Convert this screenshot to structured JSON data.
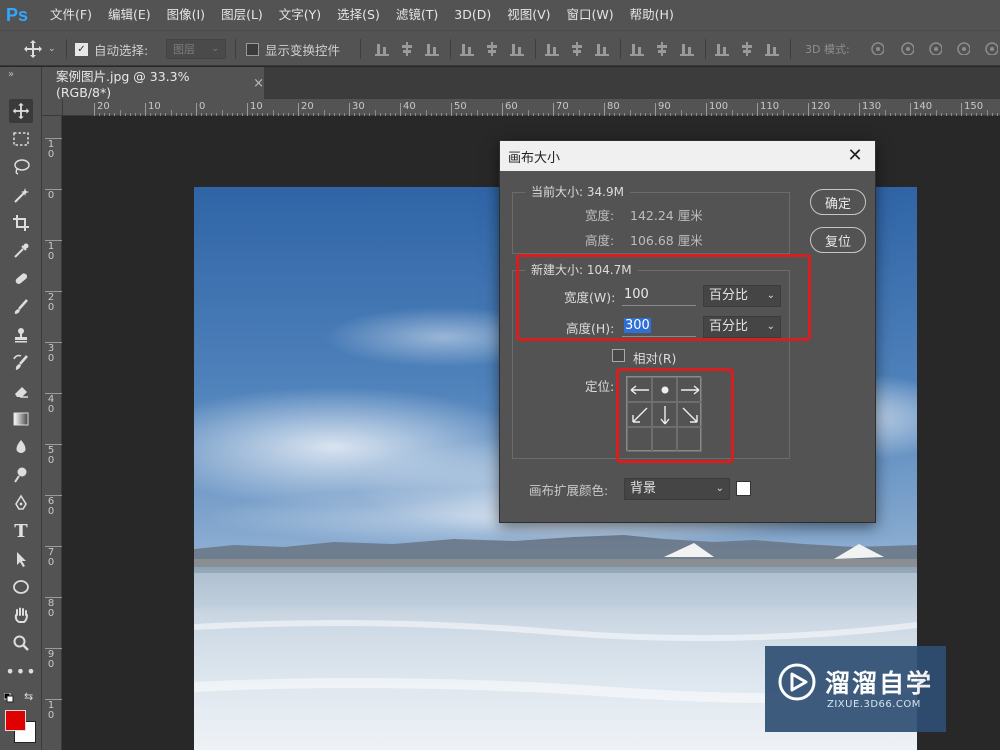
{
  "app": {
    "logo": "Ps",
    "menu": [
      "文件(F)",
      "编辑(E)",
      "图像(I)",
      "图层(L)",
      "文字(Y)",
      "选择(S)",
      "滤镜(T)",
      "3D(D)",
      "视图(V)",
      "窗口(W)",
      "帮助(H)"
    ]
  },
  "options_bar": {
    "auto_select_label": "自动选择:",
    "auto_select_checked": true,
    "layer_select": "图层",
    "show_transform_label": "显示变换控件",
    "mode_3d_label": "3D 模式:"
  },
  "document_tab": {
    "title": "案例图片.jpg @ 33.3%(RGB/8*)",
    "close": "×"
  },
  "ruler": {
    "top_ticks": [
      "20",
      "10",
      "0",
      "10",
      "20",
      "30",
      "40",
      "50",
      "60",
      "70",
      "80",
      "90",
      "100",
      "110",
      "120",
      "130",
      "140",
      "150"
    ],
    "left_ticks": [
      "1\n0",
      "0",
      "1\n0",
      "2\n0",
      "3\n0",
      "4\n0",
      "5\n0",
      "6\n0",
      "7\n0",
      "8\n0",
      "9\n0",
      "1\n0"
    ]
  },
  "dialog": {
    "title": "画布大小",
    "current_size_label": "当前大小: 34.9M",
    "current_width_label": "宽度:",
    "current_width_value": "142.24 厘米",
    "current_height_label": "高度:",
    "current_height_value": "106.68 厘米",
    "new_size_label": "新建大小: 104.7M",
    "width_label": "宽度(W):",
    "width_value": "100",
    "width_unit": "百分比",
    "height_label": "高度(H):",
    "height_value": "300",
    "height_unit": "百分比",
    "relative_label": "相对(R)",
    "relative_checked": false,
    "anchor_label": "定位:",
    "extension_color_label": "画布扩展颜色:",
    "extension_color_value": "背景",
    "extension_color_swatch": "#ffffff",
    "ok_button": "确定",
    "reset_button": "复位"
  },
  "colors": {
    "foreground": "#e00000",
    "background": "#ffffff",
    "highlight": "#d81e1e",
    "ps_blue": "#31a8ff"
  },
  "watermark": {
    "title": "溜溜自学",
    "subtitle": "ZIXUE.3D66.COM"
  }
}
